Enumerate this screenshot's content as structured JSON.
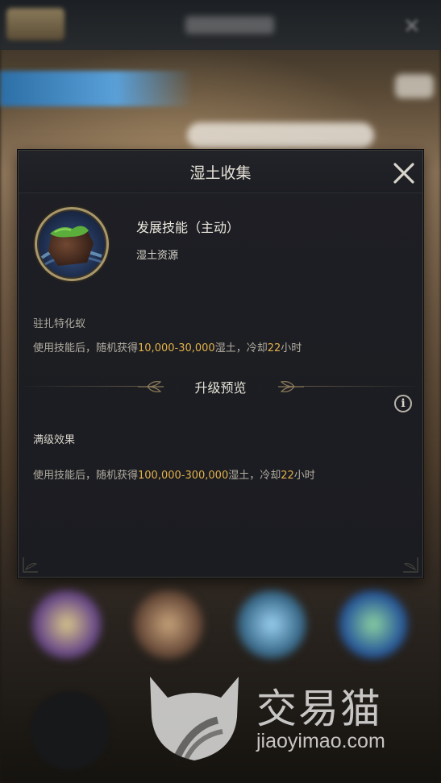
{
  "dialog": {
    "title": "湿土收集",
    "close_icon": "close-icon"
  },
  "skill": {
    "icon": "wet-soil-icon",
    "name": "发展技能（主动）",
    "type": "湿土资源"
  },
  "unit": {
    "name": "驻扎特化蚁"
  },
  "current_effect": {
    "prefix": "使用技能后，随机获得",
    "amount": "10,000-30,000",
    "mid": "湿土，冷却",
    "cooldown": "22",
    "suffix": "小时"
  },
  "upgrade": {
    "title": "升级预览",
    "info_icon": "info-icon",
    "info_glyph": "i",
    "max_title": "满级效果",
    "max_effect": {
      "prefix": "使用技能后，随机获得",
      "amount": "100,000-300,000",
      "mid": "湿土，冷却",
      "cooldown": "22",
      "suffix": "小时"
    }
  },
  "watermark": {
    "brand": "交易猫",
    "url": "jiaoyimao.com"
  },
  "colors": {
    "highlight": "#e3b04b",
    "panel": "#1e1f24",
    "frame_gold": "#a9976c"
  }
}
